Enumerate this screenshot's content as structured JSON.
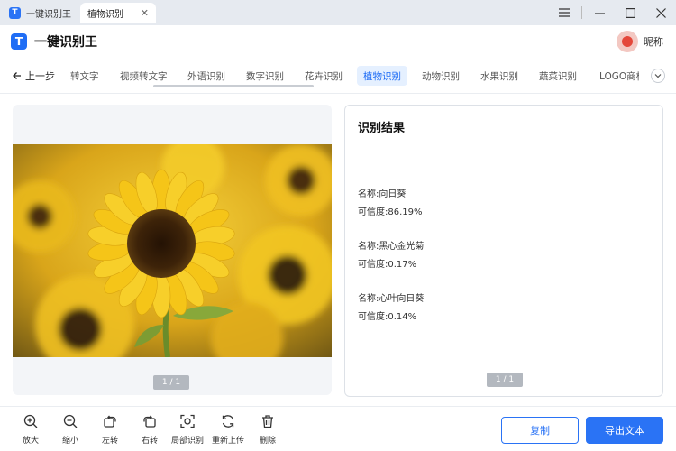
{
  "titlebar": {
    "app_name": "一键识别王",
    "tab_label": "植物识别",
    "tab_close": "✕"
  },
  "header": {
    "logo_glyph": "T",
    "title": "一键识别王",
    "nickname": "昵称"
  },
  "nav": {
    "back_label": "上一步",
    "tabs": [
      {
        "label": "转文字"
      },
      {
        "label": "视频转文字"
      },
      {
        "label": "外语识别"
      },
      {
        "label": "数字识别"
      },
      {
        "label": "花卉识别"
      },
      {
        "label": "植物识别",
        "active": true
      },
      {
        "label": "动物识别"
      },
      {
        "label": "水果识别"
      },
      {
        "label": "蔬菜识别"
      },
      {
        "label": "LOGO商标"
      }
    ]
  },
  "left_panel": {
    "pager": "1 / 1"
  },
  "result": {
    "title": "识别结果",
    "items": [
      {
        "name": "名称:向日葵",
        "confidence": "可信度:86.19%"
      },
      {
        "name": "名称:黑心金光菊",
        "confidence": "可信度:0.17%"
      },
      {
        "name": "名称:心叶向日葵",
        "confidence": "可信度:0.14%"
      }
    ],
    "pager": "1 / 1"
  },
  "toolbar": {
    "tools": [
      {
        "label": "放大",
        "icon": "zoom-in-icon"
      },
      {
        "label": "缩小",
        "icon": "zoom-out-icon"
      },
      {
        "label": "左转",
        "icon": "rotate-left-icon"
      },
      {
        "label": "右转",
        "icon": "rotate-right-icon"
      },
      {
        "label": "局部识别",
        "icon": "partial-scan-icon"
      },
      {
        "label": "重新上传",
        "icon": "reupload-icon"
      },
      {
        "label": "删除",
        "icon": "trash-icon"
      }
    ],
    "copy_label": "复制",
    "export_label": "导出文本"
  },
  "colors": {
    "accent": "#2a73f5",
    "sunflower_petal": "#f5c518",
    "sunflower_center": "#3b2208"
  }
}
